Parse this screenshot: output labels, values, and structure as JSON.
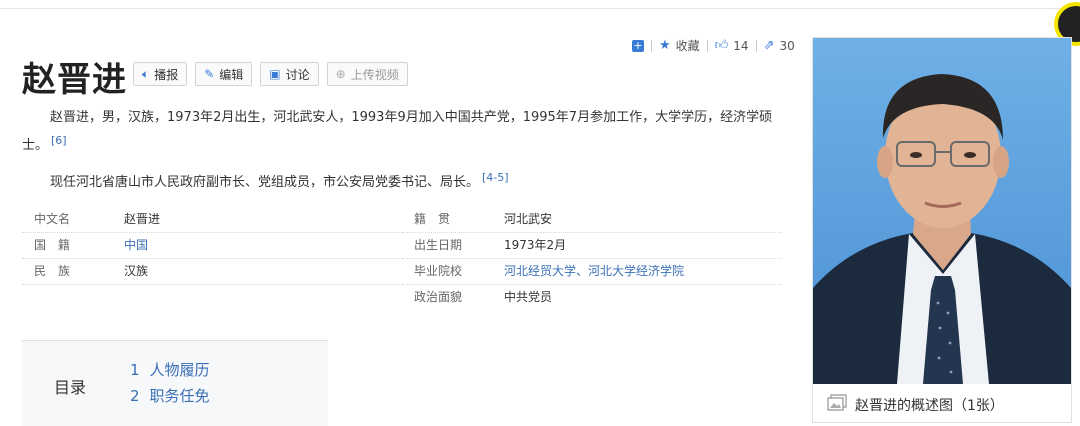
{
  "title": "赵晋进",
  "actions": [
    {
      "label": "播报",
      "icon": "speaker-icon"
    },
    {
      "label": "编辑",
      "icon": "pencil-icon"
    },
    {
      "label": "讨论",
      "icon": "chat-icon"
    },
    {
      "label": "上传视频",
      "icon": "plus-circle-icon"
    }
  ],
  "social": {
    "collect_label": "收藏",
    "like_count": "14",
    "share_count": "30"
  },
  "summary": {
    "paragraph1": "赵晋进，男，汉族，1973年2月出生，河北武安人，1993年9月加入中国共产党，1995年7月参加工作，大学学历，经济学硕士。",
    "paragraph1_ref": "[6]",
    "paragraph2": "现任河北省唐山市人民政府副市长、党组成员，市公安局党委书记、局长。",
    "paragraph2_ref": "[4-5]"
  },
  "infobox": {
    "left": [
      {
        "key": "中文名",
        "value": "赵晋进"
      },
      {
        "key": "国　籍",
        "value": "中国"
      },
      {
        "key": "民　族",
        "value": "汉族"
      }
    ],
    "right": [
      {
        "key": "籍　贯",
        "value": "河北武安"
      },
      {
        "key": "出生日期",
        "value": "1973年2月"
      },
      {
        "key": "毕业院校",
        "value": "河北经贸大学、河北大学经济学院"
      },
      {
        "key": "政治面貌",
        "value": "中共党员"
      }
    ]
  },
  "toc": {
    "label": "目录",
    "items": [
      {
        "num": "1",
        "label": "人物履历"
      },
      {
        "num": "2",
        "label": "职务任免"
      }
    ]
  },
  "photo": {
    "caption": "赵晋进的概述图（1张）"
  },
  "colors": {
    "link": "#3a6fb6",
    "accent": "#3a7bd5"
  }
}
